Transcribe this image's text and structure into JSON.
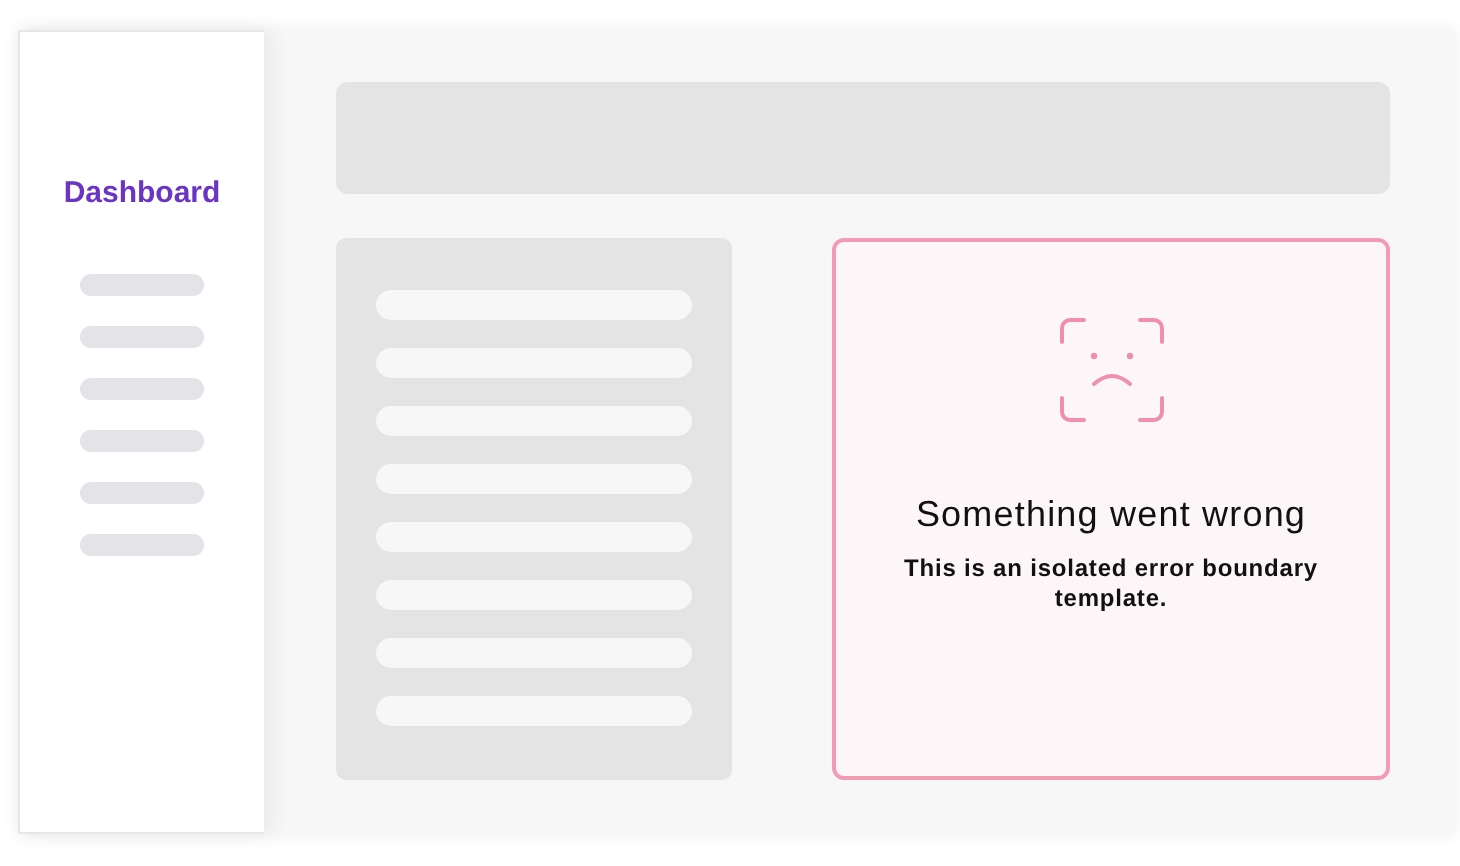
{
  "sidebar": {
    "title": "Dashboard",
    "items": [
      {
        "kind": "skeleton"
      },
      {
        "kind": "skeleton"
      },
      {
        "kind": "skeleton"
      },
      {
        "kind": "skeleton"
      },
      {
        "kind": "skeleton"
      },
      {
        "kind": "skeleton"
      }
    ]
  },
  "list_panel": {
    "items": [
      {
        "kind": "skeleton"
      },
      {
        "kind": "skeleton"
      },
      {
        "kind": "skeleton"
      },
      {
        "kind": "skeleton"
      },
      {
        "kind": "skeleton"
      },
      {
        "kind": "skeleton"
      },
      {
        "kind": "skeleton"
      },
      {
        "kind": "skeleton"
      }
    ]
  },
  "error": {
    "title": "Something went wrong",
    "message": "This is an isolated error boundary template."
  }
}
